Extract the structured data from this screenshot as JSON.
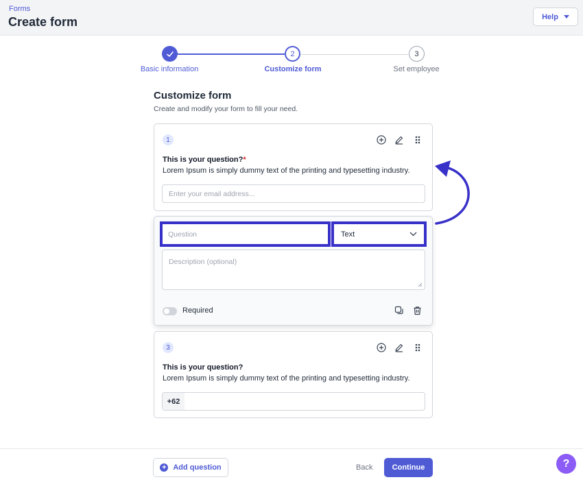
{
  "header": {
    "breadcrumb": "Forms",
    "title": "Create form",
    "help_label": "Help"
  },
  "stepper": {
    "steps": [
      {
        "number": "1",
        "label": "Basic information",
        "state": "completed"
      },
      {
        "number": "2",
        "label": "Customize form",
        "state": "active"
      },
      {
        "number": "3",
        "label": "Set employee",
        "state": "pending"
      }
    ]
  },
  "section": {
    "title": "Customize form",
    "subtitle": "Create and modify your form to fill your need."
  },
  "question1": {
    "number": "1",
    "title": "This is your question?",
    "required_mark": "*",
    "description": "Lorem Ipsum is simply dummy text of the printing and typesetting industry.",
    "placeholder": "Enter your email address..."
  },
  "editor": {
    "question_placeholder": "Question",
    "type_value": "Text",
    "description_placeholder": "Description (optional)",
    "required_label": "Required"
  },
  "question3": {
    "number": "3",
    "title": "This is your question?",
    "description": "Lorem Ipsum is simply dummy text of the printing and typesetting industry.",
    "prefix": "+62"
  },
  "footer": {
    "add_label": "Add question",
    "back_label": "Back",
    "continue_label": "Continue",
    "fab_label": "?"
  },
  "colors": {
    "accent": "#4f5bd5",
    "highlight": "#3730c9",
    "fab": "#8b5cf6",
    "required": "#dc2626"
  }
}
